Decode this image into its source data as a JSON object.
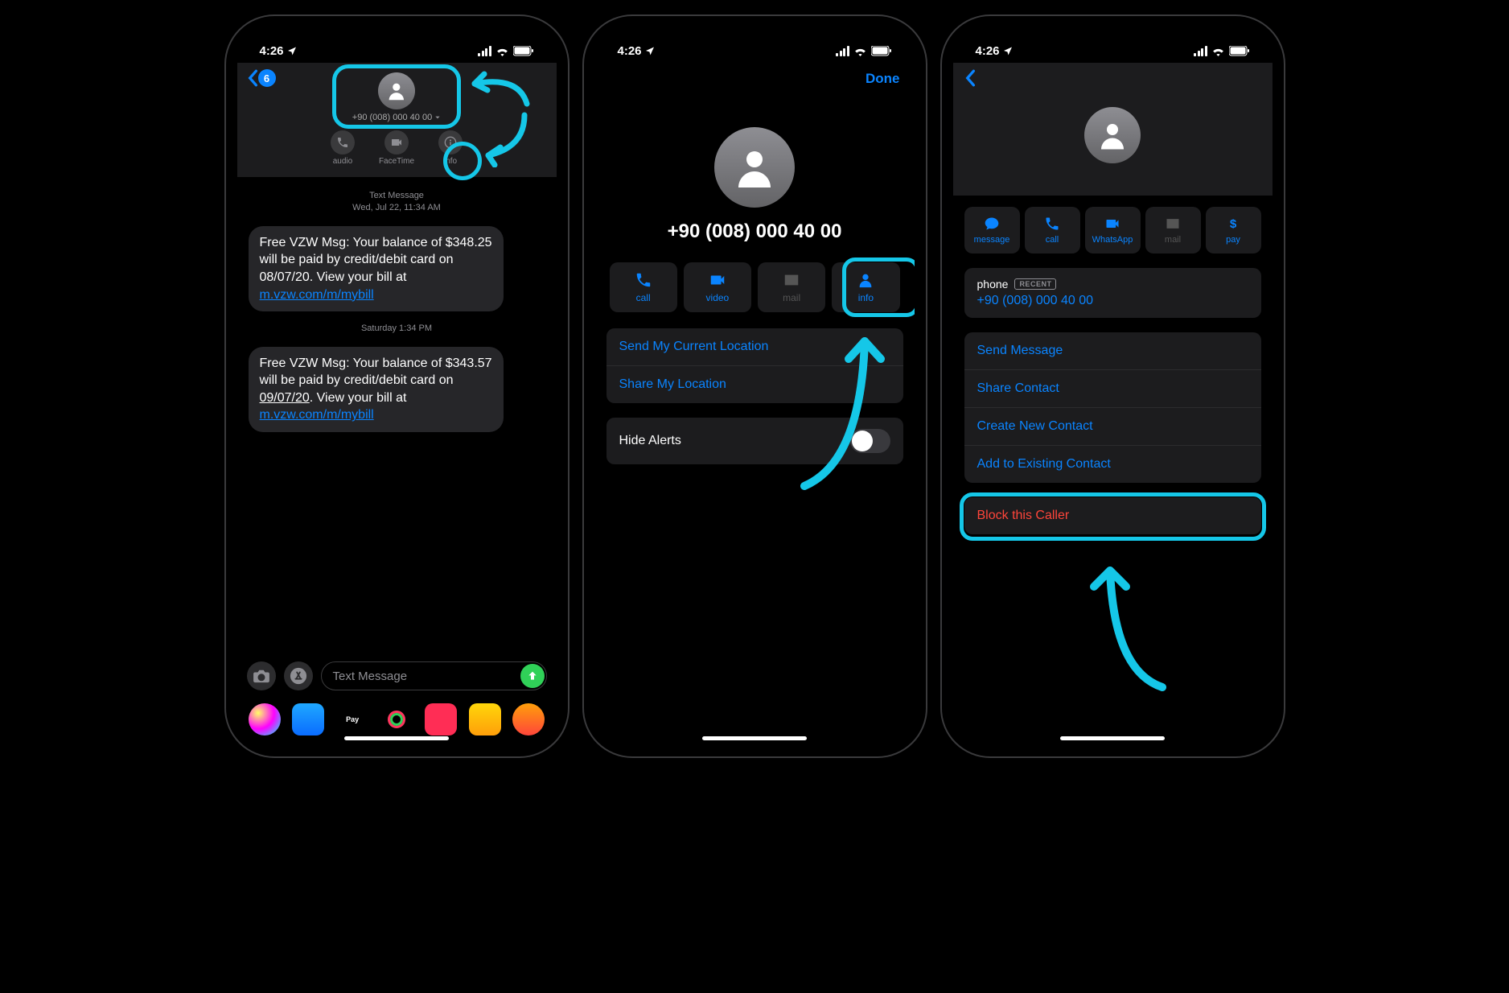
{
  "status": {
    "time": "4:26"
  },
  "screen1": {
    "back_count": "6",
    "contact_name": "+90 (008) 000 40 00",
    "actions": {
      "audio": "audio",
      "facetime": "FaceTime",
      "info": "info"
    },
    "ts1_line1": "Text Message",
    "ts1_line2": "Wed, Jul 22, 11:34 AM",
    "msg1_pre": "Free VZW Msg: Your balance of $348.25 will be paid by credit/debit card on 08/07/20. View your bill at ",
    "msg1_link": "m.vzw.com/m/mybill",
    "ts2": "Saturday 1:34 PM",
    "msg2_pre": "Free VZW Msg: Your balance of $343.57 will be paid by credit/debit card on ",
    "msg2_date": "09/07/20",
    "msg2_post": ". View your bill at ",
    "msg2_link": "m.vzw.com/m/mybill",
    "input_placeholder": "Text Message"
  },
  "screen2": {
    "done": "Done",
    "phone": "+90 (008) 000 40 00",
    "tiles": {
      "call": "call",
      "video": "video",
      "mail": "mail",
      "info": "info"
    },
    "rows": {
      "send_loc": "Send My Current Location",
      "share_loc": "Share My Location",
      "hide_alerts": "Hide Alerts"
    }
  },
  "screen3": {
    "tiles": {
      "message": "message",
      "call": "call",
      "whatsapp": "WhatsApp",
      "mail": "mail",
      "pay": "pay"
    },
    "phone_label": "phone",
    "recent": "RECENT",
    "phone_value": "+90 (008) 000 40 00",
    "rows": {
      "send_msg": "Send Message",
      "share_contact": "Share Contact",
      "create_contact": "Create New Contact",
      "add_existing": "Add to Existing Contact",
      "block": "Block this Caller"
    }
  }
}
